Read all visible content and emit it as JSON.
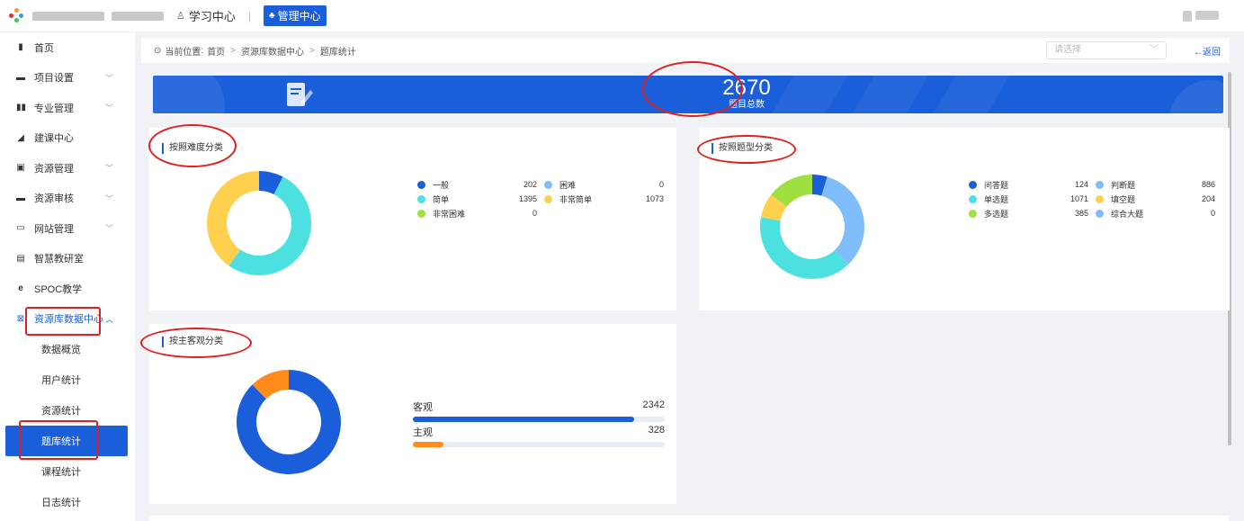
{
  "topbar": {
    "learning_center": "学习中心",
    "admin_center": "管理中心"
  },
  "sidebar": {
    "items": [
      {
        "label": "首页",
        "icon": "home-icon"
      },
      {
        "label": "项目设置",
        "icon": "folder-icon",
        "chevron": "﹀"
      },
      {
        "label": "专业管理",
        "icon": "grid-icon",
        "chevron": "﹀"
      },
      {
        "label": "建课中心",
        "icon": "send-icon"
      },
      {
        "label": "资源管理",
        "icon": "box-icon",
        "chevron": "﹀"
      },
      {
        "label": "资源审核",
        "icon": "folder-icon",
        "chevron": "﹀"
      },
      {
        "label": "网站管理",
        "icon": "monitor-icon",
        "chevron": "﹀"
      },
      {
        "label": "智慧教研室",
        "icon": "doc-icon"
      },
      {
        "label": "SPOC教学",
        "icon": "ie-icon"
      },
      {
        "label": "资源库数据中心",
        "icon": "chart-icon",
        "chevron": "︿"
      }
    ],
    "sub_items": [
      "数据概览",
      "用户统计",
      "资源统计",
      "题库统计",
      "课程统计",
      "日志统计"
    ]
  },
  "breadcrumb": {
    "prefix": "当前位置",
    "items": [
      "首页",
      "资源库数据中心",
      "题库统计"
    ],
    "separator": ">"
  },
  "select": {
    "placeholder": "请选择"
  },
  "back_label": "←返回",
  "banner": {
    "total": "2670",
    "label": "题目总数"
  },
  "difficulty": {
    "title": "按照难度分类",
    "legend": [
      {
        "name": "一般",
        "value": "202",
        "color": "#1a5fd9"
      },
      {
        "name": "困难",
        "value": "0",
        "color": "#7fbdfa"
      },
      {
        "name": "简单",
        "value": "1395",
        "color": "#4de0e0"
      },
      {
        "name": "非常简单",
        "value": "1073",
        "color": "#ffd04d"
      },
      {
        "name": "非常困难",
        "value": "0",
        "color": "#9fe040"
      }
    ]
  },
  "qtype": {
    "title": "按照题型分类",
    "legend": [
      {
        "name": "问答题",
        "value": "124",
        "color": "#1a5fd9"
      },
      {
        "name": "判断题",
        "value": "886",
        "color": "#7fbdfa"
      },
      {
        "name": "单选题",
        "value": "1071",
        "color": "#4de0e0"
      },
      {
        "name": "填空题",
        "value": "204",
        "color": "#ffd04d"
      },
      {
        "name": "多选题",
        "value": "385",
        "color": "#9fe040"
      },
      {
        "name": "综合大题",
        "value": "0",
        "color": "#7fbdfa"
      }
    ]
  },
  "objective": {
    "title": "按主客观分类",
    "rows": [
      {
        "name": "客观",
        "value": "2342",
        "fraction": 0.877,
        "color": "#1a5fd9"
      },
      {
        "name": "主观",
        "value": "328",
        "fraction": 0.123,
        "color": "#ff8c1a"
      }
    ]
  }
}
